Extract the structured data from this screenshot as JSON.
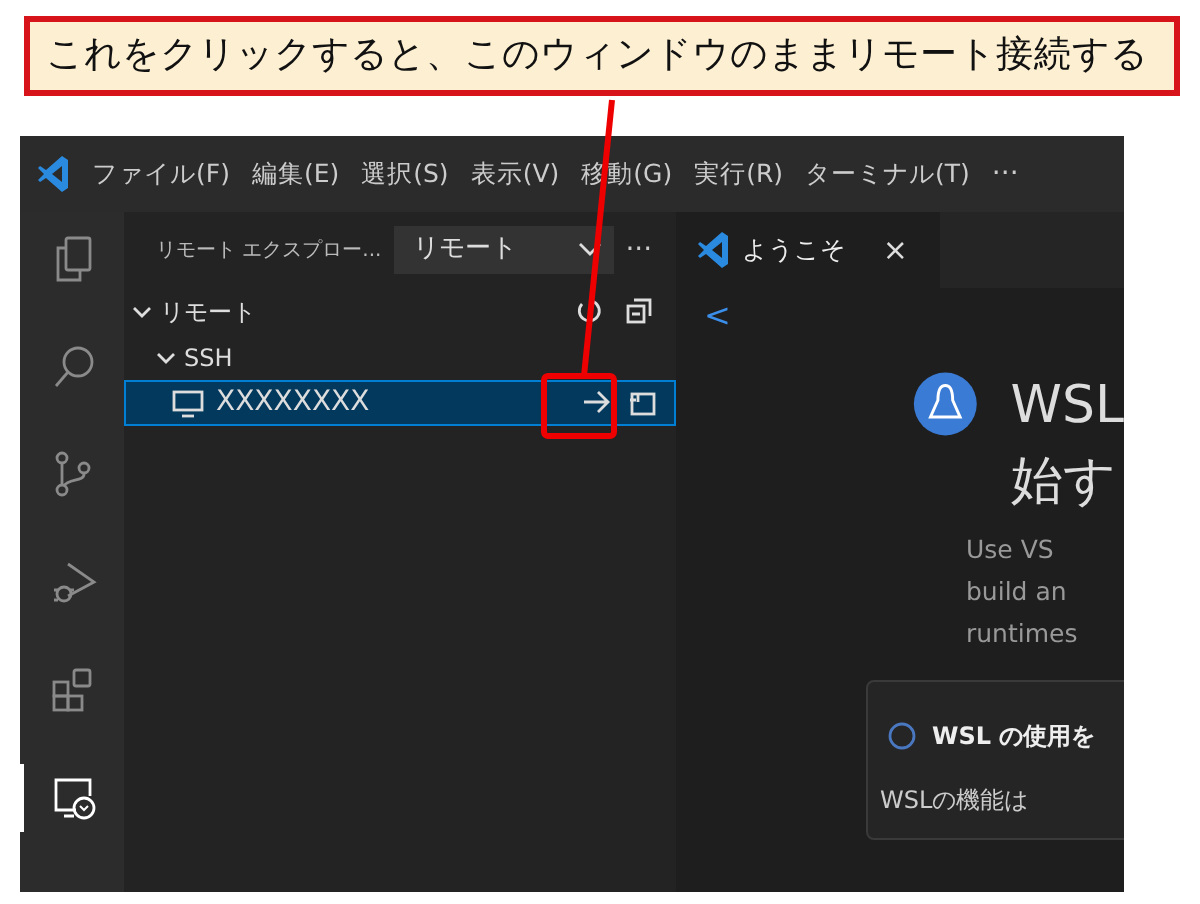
{
  "callout": {
    "text": "これをクリックすると、このウィンドウのままリモート接続する"
  },
  "menu_bar": {
    "items": [
      "ファイル(F)",
      "編集(E)",
      "選択(S)",
      "表示(V)",
      "移動(G)",
      "実行(R)",
      "ターミナル(T)"
    ],
    "more": "···"
  },
  "activity_bar": {
    "items": [
      {
        "kind": "explorer",
        "selected": false
      },
      {
        "kind": "search",
        "selected": false
      },
      {
        "kind": "source-control",
        "selected": false
      },
      {
        "kind": "run-debug",
        "selected": false
      },
      {
        "kind": "extensions",
        "selected": false
      },
      {
        "kind": "remote",
        "selected": true
      }
    ]
  },
  "sidebar": {
    "title": "リモート エクスプロー...",
    "dropdown": "リモート",
    "more": "···",
    "tree": [
      {
        "label": "リモート",
        "expanded": true,
        "children": [
          {
            "label": "SSH",
            "expanded": true,
            "children": [
              {
                "label": "XXXXXXXX",
                "selected": true
              }
            ]
          }
        ]
      }
    ]
  },
  "editor": {
    "tabs": [
      {
        "label": "ようこそ",
        "close": "×",
        "selected": true
      }
    ],
    "back": "<",
    "heading_lines": [
      "WSL",
      "始す"
    ],
    "description_lines": [
      "Use VS",
      "build an",
      "runtimes"
    ],
    "card": {
      "title": "WSL の使用を",
      "body": "WSLの機能は"
    }
  }
}
